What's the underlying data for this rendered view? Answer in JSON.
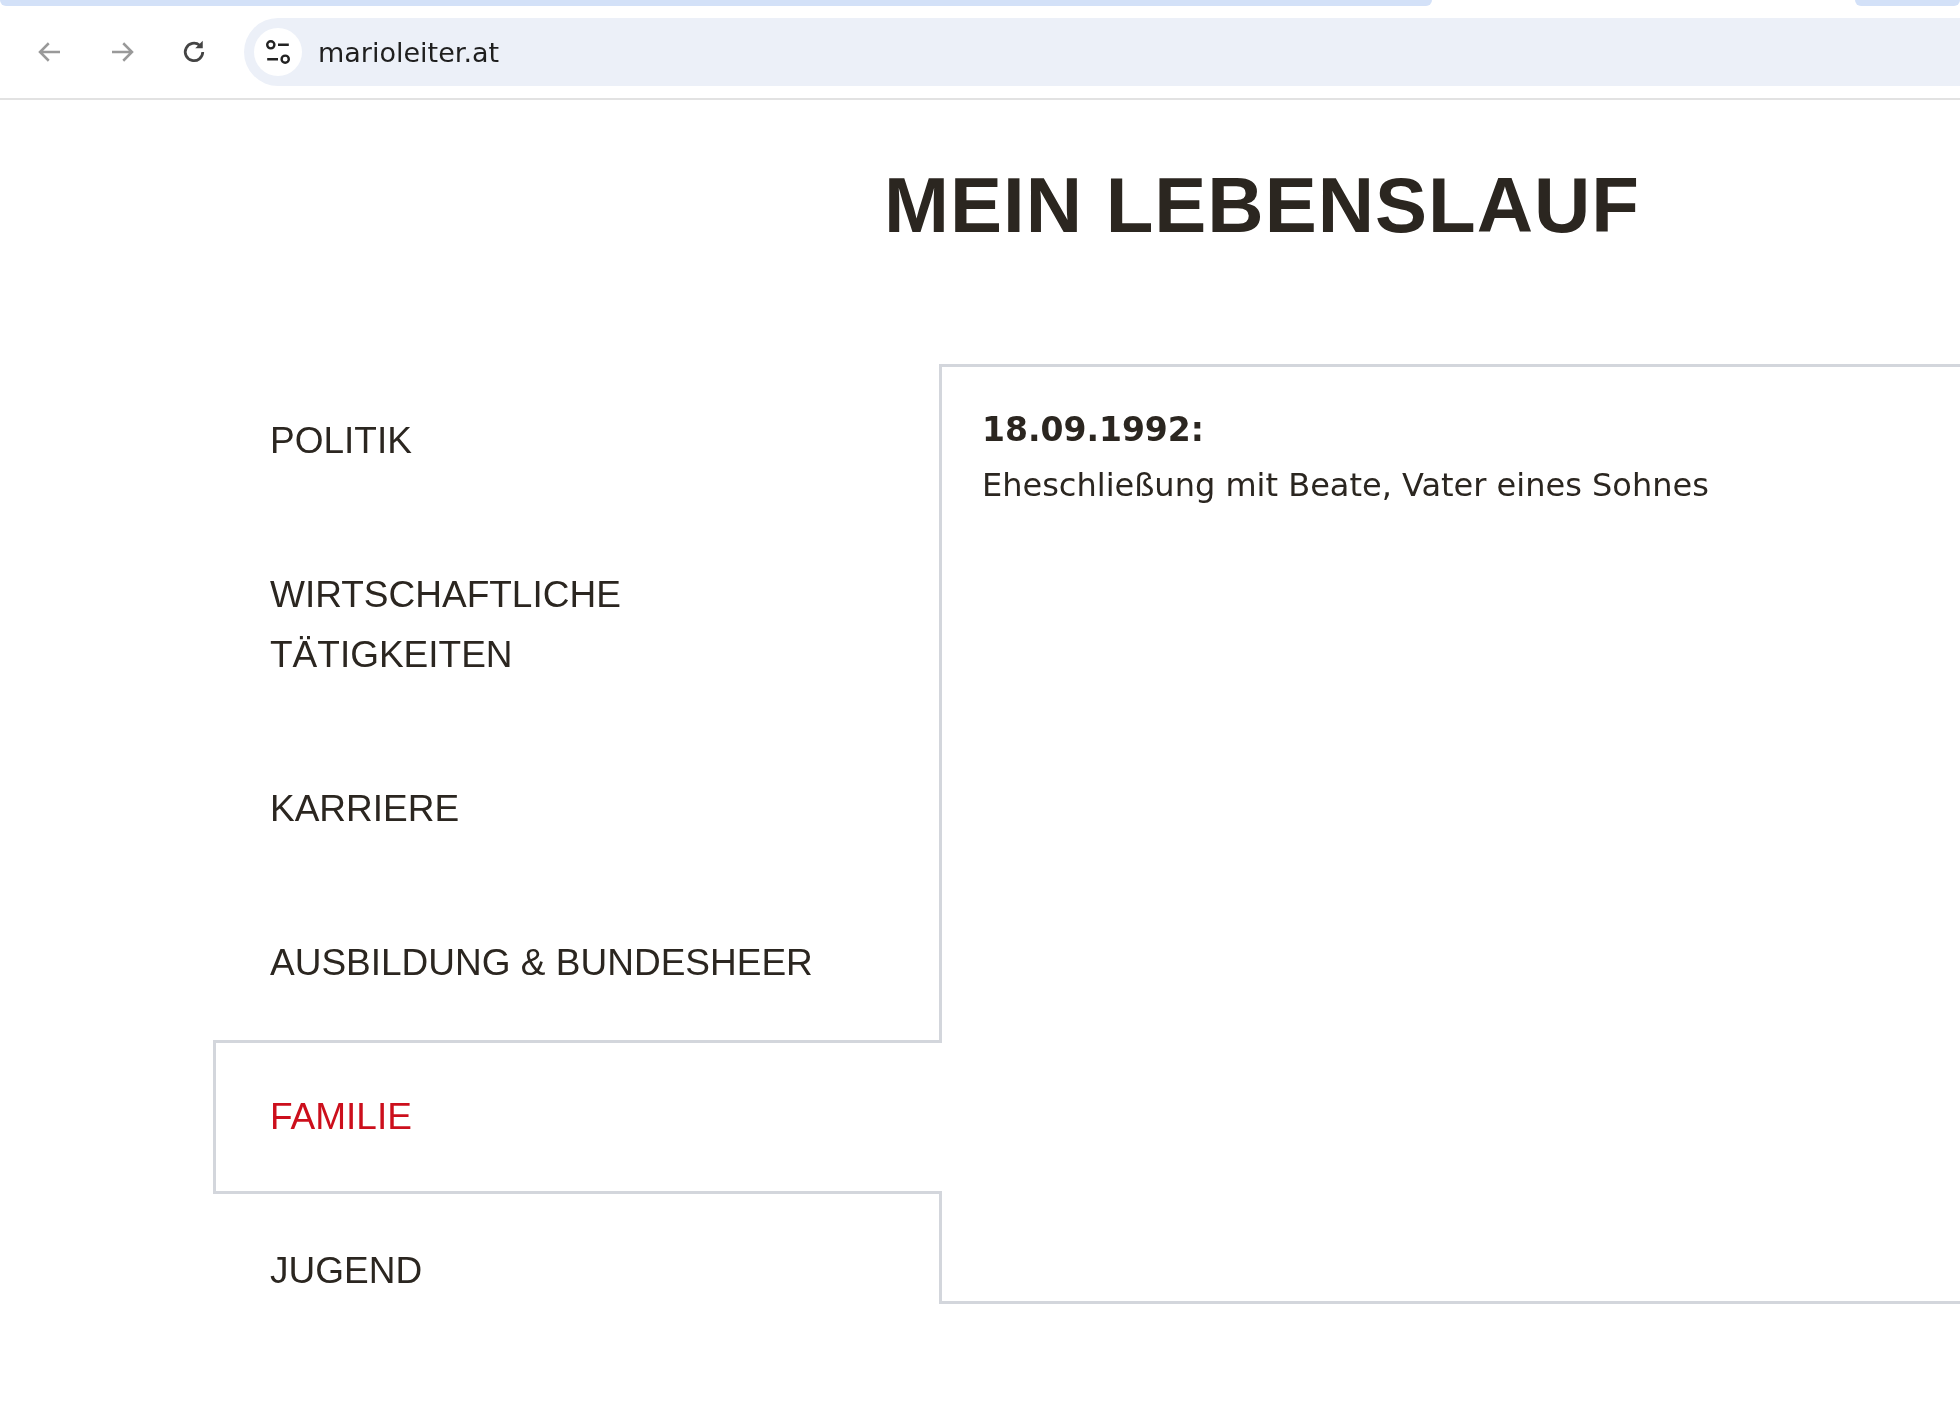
{
  "browser": {
    "url": "marioleiter.at"
  },
  "page": {
    "title": "MEIN LEBENSLAUF"
  },
  "tabs": [
    {
      "label": "POLITIK",
      "selected": false
    },
    {
      "label": "WIRTSCHAFTLICHE TÄTIGKEITEN",
      "selected": false
    },
    {
      "label": "KARRIERE",
      "selected": false
    },
    {
      "label": "AUSBILDUNG & BUNDESHEER",
      "selected": false
    },
    {
      "label": "FAMILIE",
      "selected": true
    },
    {
      "label": "JUGEND",
      "selected": false
    }
  ],
  "entries": [
    {
      "date": "18.09.1992:",
      "text": "Eheschließung mit Beate, Vater eines Sohnes"
    }
  ]
}
